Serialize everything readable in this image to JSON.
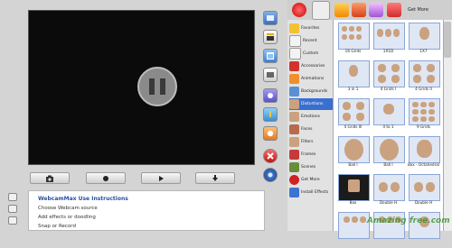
{
  "controls": [
    "camera",
    "record",
    "play",
    "download"
  ],
  "instructions": {
    "title": "WebcamMax Use Instructions",
    "lines": [
      "Choose Webcam source",
      "Add effects or doodling",
      "Snap or Record"
    ]
  },
  "tabs": {
    "get_more": "Get More"
  },
  "categories": [
    "Favorites",
    "Recent",
    "Custom",
    "Accessories",
    "Animations",
    "Backgrounds",
    "Distortions",
    "Emotions",
    "Faces",
    "Filters",
    "Frames",
    "Scenes",
    "Get More",
    "Install Effects"
  ],
  "selected_category": "Distortions",
  "effects": [
    "16 Grids",
    "1X1D",
    "1X7",
    "3 in 1",
    "4 Grids I",
    "4 Grids II",
    "4 Grids III",
    "4 to 1",
    "9 Grids",
    "Ball I",
    "Ball I",
    "Box - Octahedral",
    "Box",
    "Double H",
    "Double H"
  ],
  "watermark": "Amazing free.com"
}
